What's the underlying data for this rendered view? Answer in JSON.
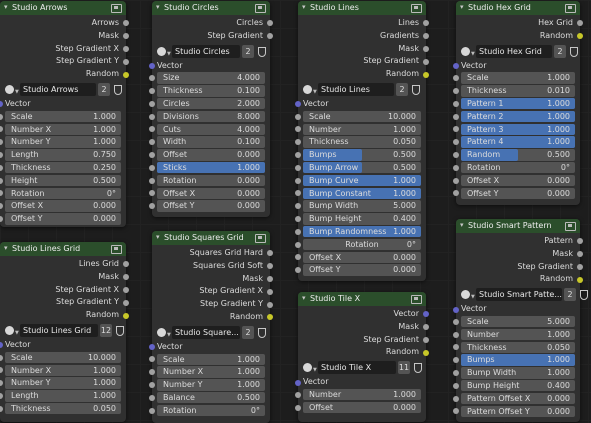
{
  "colors": {
    "header_green": "#2b4e2b",
    "socket_gray": "#a1a1a1",
    "socket_yellow": "#c7c729",
    "socket_vector": "#6363c7",
    "field_bg": "#545454",
    "slider_blue": "#4772b3"
  },
  "nodes": {
    "arrows": {
      "title": "Studio Arrows",
      "outputs": [
        "Arrows",
        "Mask",
        "Step Gradient X",
        "Step Gradient Y",
        "Random"
      ],
      "selector": {
        "name": "Studio Arrows",
        "count": "2"
      },
      "vector_label": "Vector",
      "fields": [
        {
          "label": "Scale",
          "value": "1.000"
        },
        {
          "label": "Number X",
          "value": "1.000"
        },
        {
          "label": "Number Y",
          "value": "1.000"
        },
        {
          "label": "Length",
          "value": "0.750"
        },
        {
          "label": "Thickness",
          "value": "0.250"
        },
        {
          "label": "Height",
          "value": "0.500"
        },
        {
          "label": "Rotation",
          "value": "0°"
        },
        {
          "label": "Offset X",
          "value": "0.000"
        },
        {
          "label": "Offset Y",
          "value": "0.000"
        }
      ]
    },
    "circles": {
      "title": "Studio Circles",
      "outputs": [
        "Circles",
        "Step Gradient"
      ],
      "selector": {
        "name": "Studio Circles",
        "count": "2"
      },
      "vector_label": "Vector",
      "fields": [
        {
          "label": "Size",
          "value": "4.000"
        },
        {
          "label": "Thickness",
          "value": "0.100"
        },
        {
          "label": "Circles",
          "value": "2.000"
        },
        {
          "label": "Divisions",
          "value": "8.000"
        },
        {
          "label": "Cuts",
          "value": "4.000"
        },
        {
          "label": "Width",
          "value": "0.100"
        },
        {
          "label": "Offset",
          "value": "0.000"
        },
        {
          "label": "Sticks",
          "value": "1.000",
          "fill": 1.0
        },
        {
          "label": "Rotation",
          "value": "0.000"
        },
        {
          "label": "Offset X",
          "value": "0.000"
        },
        {
          "label": "Offset Y",
          "value": "0.000"
        }
      ]
    },
    "lines": {
      "title": "Studio Lines",
      "outputs": [
        "Lines",
        "Gradients",
        "Mask",
        "Step Gradient",
        "Random"
      ],
      "selector": {
        "name": "Studio Lines",
        "count": "2"
      },
      "vector_label": "Vector",
      "fields": [
        {
          "label": "Scale",
          "value": "10.000"
        },
        {
          "label": "Number",
          "value": "1.000"
        },
        {
          "label": "Thickness",
          "value": "0.050"
        },
        {
          "label": "Bumps",
          "value": "0.500",
          "fill": 0.5
        },
        {
          "label": "Bump Arrow",
          "value": "0.500",
          "fill": 0.5
        },
        {
          "label": "Bump Curve",
          "value": "1.000",
          "fill": 1.0
        },
        {
          "label": "Bump Constant",
          "value": "1.000",
          "fill": 1.0
        },
        {
          "label": "Bump Width",
          "value": "5.000"
        },
        {
          "label": "Bump Height",
          "value": "0.400"
        },
        {
          "label": "Bump Randomness",
          "value": "1.000",
          "fill": 1.0
        },
        {
          "label": "Rotation",
          "value": "0°",
          "center": true
        },
        {
          "label": "Offset X",
          "value": "0.000"
        },
        {
          "label": "Offset Y",
          "value": "0.000"
        }
      ]
    },
    "hexgrid": {
      "title": "Studio Hex Grid",
      "outputs": [
        "Hex Grid",
        "Random"
      ],
      "selector": {
        "name": "Studio Hex Grid",
        "count": "2"
      },
      "vector_label": "Vector",
      "fields": [
        {
          "label": "Scale",
          "value": "1.000"
        },
        {
          "label": "Thickness",
          "value": "0.010"
        },
        {
          "label": "Pattern 1",
          "value": "1.000",
          "fill": 1.0
        },
        {
          "label": "Pattern 2",
          "value": "1.000",
          "fill": 1.0
        },
        {
          "label": "Pattern 3",
          "value": "1.000",
          "fill": 1.0
        },
        {
          "label": "Pattern 4",
          "value": "1.000",
          "fill": 1.0
        },
        {
          "label": "Random",
          "value": "0.500",
          "fill": 0.5
        },
        {
          "label": "Rotation",
          "value": "0°"
        },
        {
          "label": "Offset X",
          "value": "0.000"
        },
        {
          "label": "Offset Y",
          "value": "0.000"
        }
      ]
    },
    "linesgrid": {
      "title": "Studio Lines Grid",
      "outputs": [
        "Lines Grid",
        "Mask",
        "Step Gradient X",
        "Step Gradient Y",
        "Random"
      ],
      "selector": {
        "name": "Studio Lines Grid",
        "count": "12"
      },
      "vector_label": "Vector",
      "fields": [
        {
          "label": "Scale",
          "value": "10.000"
        },
        {
          "label": "Number X",
          "value": "1.000"
        },
        {
          "label": "Number Y",
          "value": "1.000"
        },
        {
          "label": "Length",
          "value": "1.000"
        },
        {
          "label": "Thickness",
          "value": "0.050"
        }
      ]
    },
    "squaresgrid": {
      "title": "Studio Squares Grid",
      "outputs": [
        "Squares Grid Hard",
        "Squares Grid Soft",
        "Mask",
        "Step Gradient X",
        "Step Gradient Y",
        "Random"
      ],
      "selector": {
        "name": "Studio Square...",
        "count": "2"
      },
      "vector_label": "Vector",
      "fields": [
        {
          "label": "Scale",
          "value": "1.000"
        },
        {
          "label": "Number X",
          "value": "1.000"
        },
        {
          "label": "Number Y",
          "value": "1.000"
        },
        {
          "label": "Balance",
          "value": "0.500"
        },
        {
          "label": "Rotation",
          "value": "0°"
        }
      ]
    },
    "tilex": {
      "title": "Studio Tile X",
      "outputs": [
        "Vector",
        "Mask",
        "Step Gradient",
        "Random"
      ],
      "selector": {
        "name": "Studio Tile X",
        "count": "11"
      },
      "vector_label": "Vector",
      "fields": [
        {
          "label": "Number",
          "value": "1.000"
        },
        {
          "label": "Offset",
          "value": "0.000"
        }
      ]
    },
    "smartpattern": {
      "title": "Studio Smart Pattern",
      "outputs": [
        "Pattern",
        "Mask",
        "Step Gradient",
        "Random"
      ],
      "selector": {
        "name": "Studio Smart Patte...",
        "count": "2"
      },
      "vector_label": "Vector",
      "fields": [
        {
          "label": "Scale",
          "value": "5.000"
        },
        {
          "label": "Number",
          "value": "1.000"
        },
        {
          "label": "Thickness",
          "value": "0.050"
        },
        {
          "label": "Bumps",
          "value": "1.000",
          "fill": 1.0
        },
        {
          "label": "Bump Width",
          "value": "1.000"
        },
        {
          "label": "Bump Height",
          "value": "0.400"
        },
        {
          "label": "Pattern Offset X",
          "value": "0.000"
        },
        {
          "label": "Pattern Offset Y",
          "value": "0.000"
        }
      ]
    }
  }
}
